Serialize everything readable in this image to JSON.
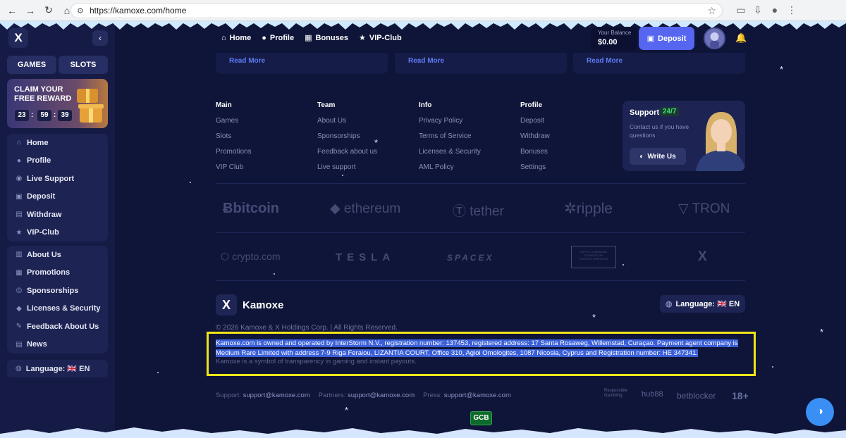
{
  "browser": {
    "url": "https://kamoxe.com/home"
  },
  "sidebar": {
    "tabs": [
      "GAMES",
      "SLOTS"
    ],
    "promo": {
      "title": "CLAIM YOUR FREE REWARD",
      "timer": [
        "23",
        "59",
        "39"
      ]
    },
    "menu1": [
      {
        "label": "Home",
        "icon": "home-icon"
      },
      {
        "label": "Profile",
        "icon": "user-icon"
      },
      {
        "label": "Live Support",
        "icon": "support-icon"
      },
      {
        "label": "Deposit",
        "icon": "wallet-icon"
      },
      {
        "label": "Withdraw",
        "icon": "withdraw-icon"
      },
      {
        "label": "VIP-Club",
        "icon": "star-icon"
      }
    ],
    "menu2": [
      {
        "label": "About Us",
        "icon": "book-icon"
      },
      {
        "label": "Promotions",
        "icon": "gift-icon"
      },
      {
        "label": "Sponsorships",
        "icon": "medal-icon"
      },
      {
        "label": "Licenses & Security",
        "icon": "shield-icon"
      },
      {
        "label": "Feedback About Us",
        "icon": "feedback-icon"
      },
      {
        "label": "News",
        "icon": "news-icon"
      }
    ],
    "language": "Language: 🇬🇧 EN"
  },
  "header": {
    "nav": [
      {
        "label": "Home",
        "icon": "home-icon"
      },
      {
        "label": "Profile",
        "icon": "user-icon"
      },
      {
        "label": "Bonuses",
        "icon": "gift-icon"
      },
      {
        "label": "VIP-Club",
        "icon": "star-icon"
      }
    ],
    "balance_label": "Your Balance",
    "balance_value": "$0.00",
    "deposit_label": "Deposit"
  },
  "cards": {
    "read_more": "Read More"
  },
  "footer": {
    "columns": [
      {
        "title": "Main",
        "links": [
          "Games",
          "Slots",
          "Promotions",
          "VIP Club"
        ]
      },
      {
        "title": "Team",
        "links": [
          "About Us",
          "Sponsorships",
          "Feedback about us",
          "Live support"
        ]
      },
      {
        "title": "Info",
        "links": [
          "Privacy Policy",
          "Terms of Service",
          "Licenses & Security",
          "AML Policy"
        ]
      },
      {
        "title": "Profile",
        "links": [
          "Deposit",
          "Withdraw",
          "Bonuses",
          "Settings"
        ]
      }
    ],
    "support": {
      "title": "Support",
      "badge": "24/7",
      "subtitle": "Contact us if you have questions",
      "button": "Write Us"
    },
    "partners_row1": [
      "bitcoin",
      "ethereum",
      "tether",
      "ripple",
      "TRON"
    ],
    "partners_row2": [
      "crypto.com",
      "TESLA",
      "SPACEX",
      "CRYPTO GAMBLING FOUNDATION",
      "X"
    ],
    "verified_operator": "VERIFIED OPERATOR",
    "brand": "Kamoxe",
    "language": "Language: 🇬🇧 EN",
    "copyright": "© 2026 Kamoxe & X Holdings Corp. | All Rights Reserved.",
    "legal": "Kamoxe.com is owned and operated by InterStorm N.V., registration number: 137453, registered address: 17 Santa Rosaweg, Willemstad, Curaçao. Payment agent company is Medium Rare Limited with address 7-9 Riga Feraiou, LIZANTIA COURT, Office 310, Agioi Omologites, 1087 Nicosia, Cyprus and Registration number: HE 347341.",
    "tagline": "Kamoxe is a symbol of transparency in gaming and instant payouts.",
    "contacts": [
      {
        "label": "Support:",
        "value": "support@kamoxe.com"
      },
      {
        "label": "Partners:",
        "value": "support@kamoxe.com"
      },
      {
        "label": "Press:",
        "value": "support@kamoxe.com"
      }
    ],
    "responsible": "Responsible Gambling",
    "hub88": "hub88",
    "betblocker": "betblocker",
    "age": "18+",
    "gcb": "GCB"
  },
  "colors": {
    "accent": "#5666f0",
    "highlight_border": "#f2e317",
    "selection": "#3a5fd8"
  }
}
